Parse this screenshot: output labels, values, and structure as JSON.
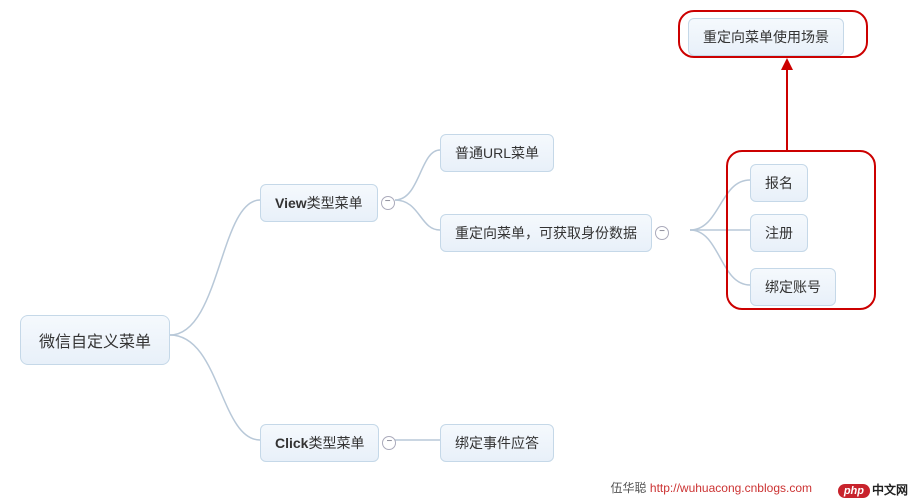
{
  "root": {
    "label": "微信自定义菜单"
  },
  "branches": {
    "view": {
      "prefix": "View",
      "suffix": "类型菜单"
    },
    "click": {
      "prefix": "Click",
      "suffix": "类型菜单"
    }
  },
  "view_children": {
    "plain_url": "普通URL菜单",
    "redirect": "重定向菜单，可获取身份数据"
  },
  "click_children": {
    "event_bind": "绑定事件应答"
  },
  "redirect_children": {
    "signup": "报名",
    "register": "注册",
    "bind_account": "绑定账号"
  },
  "callout": {
    "label": "重定向菜单使用场景"
  },
  "footer": {
    "author": "伍华聪",
    "url": "http://wuhuacong.cnblogs.com"
  },
  "logo": {
    "badge": "php",
    "text": "中文网"
  },
  "collapse_glyph": "−",
  "chart_data": {
    "type": "tree",
    "title": "",
    "root": {
      "label": "微信自定义菜单",
      "children": [
        {
          "label": "View类型菜单",
          "children": [
            {
              "label": "普通URL菜单"
            },
            {
              "label": "重定向菜单，可获取身份数据",
              "children": [
                {
                  "label": "报名"
                },
                {
                  "label": "注册"
                },
                {
                  "label": "绑定账号"
                }
              ],
              "annotation": "重定向菜单使用场景"
            }
          ]
        },
        {
          "label": "Click类型菜单",
          "children": [
            {
              "label": "绑定事件应答"
            }
          ]
        }
      ]
    }
  }
}
